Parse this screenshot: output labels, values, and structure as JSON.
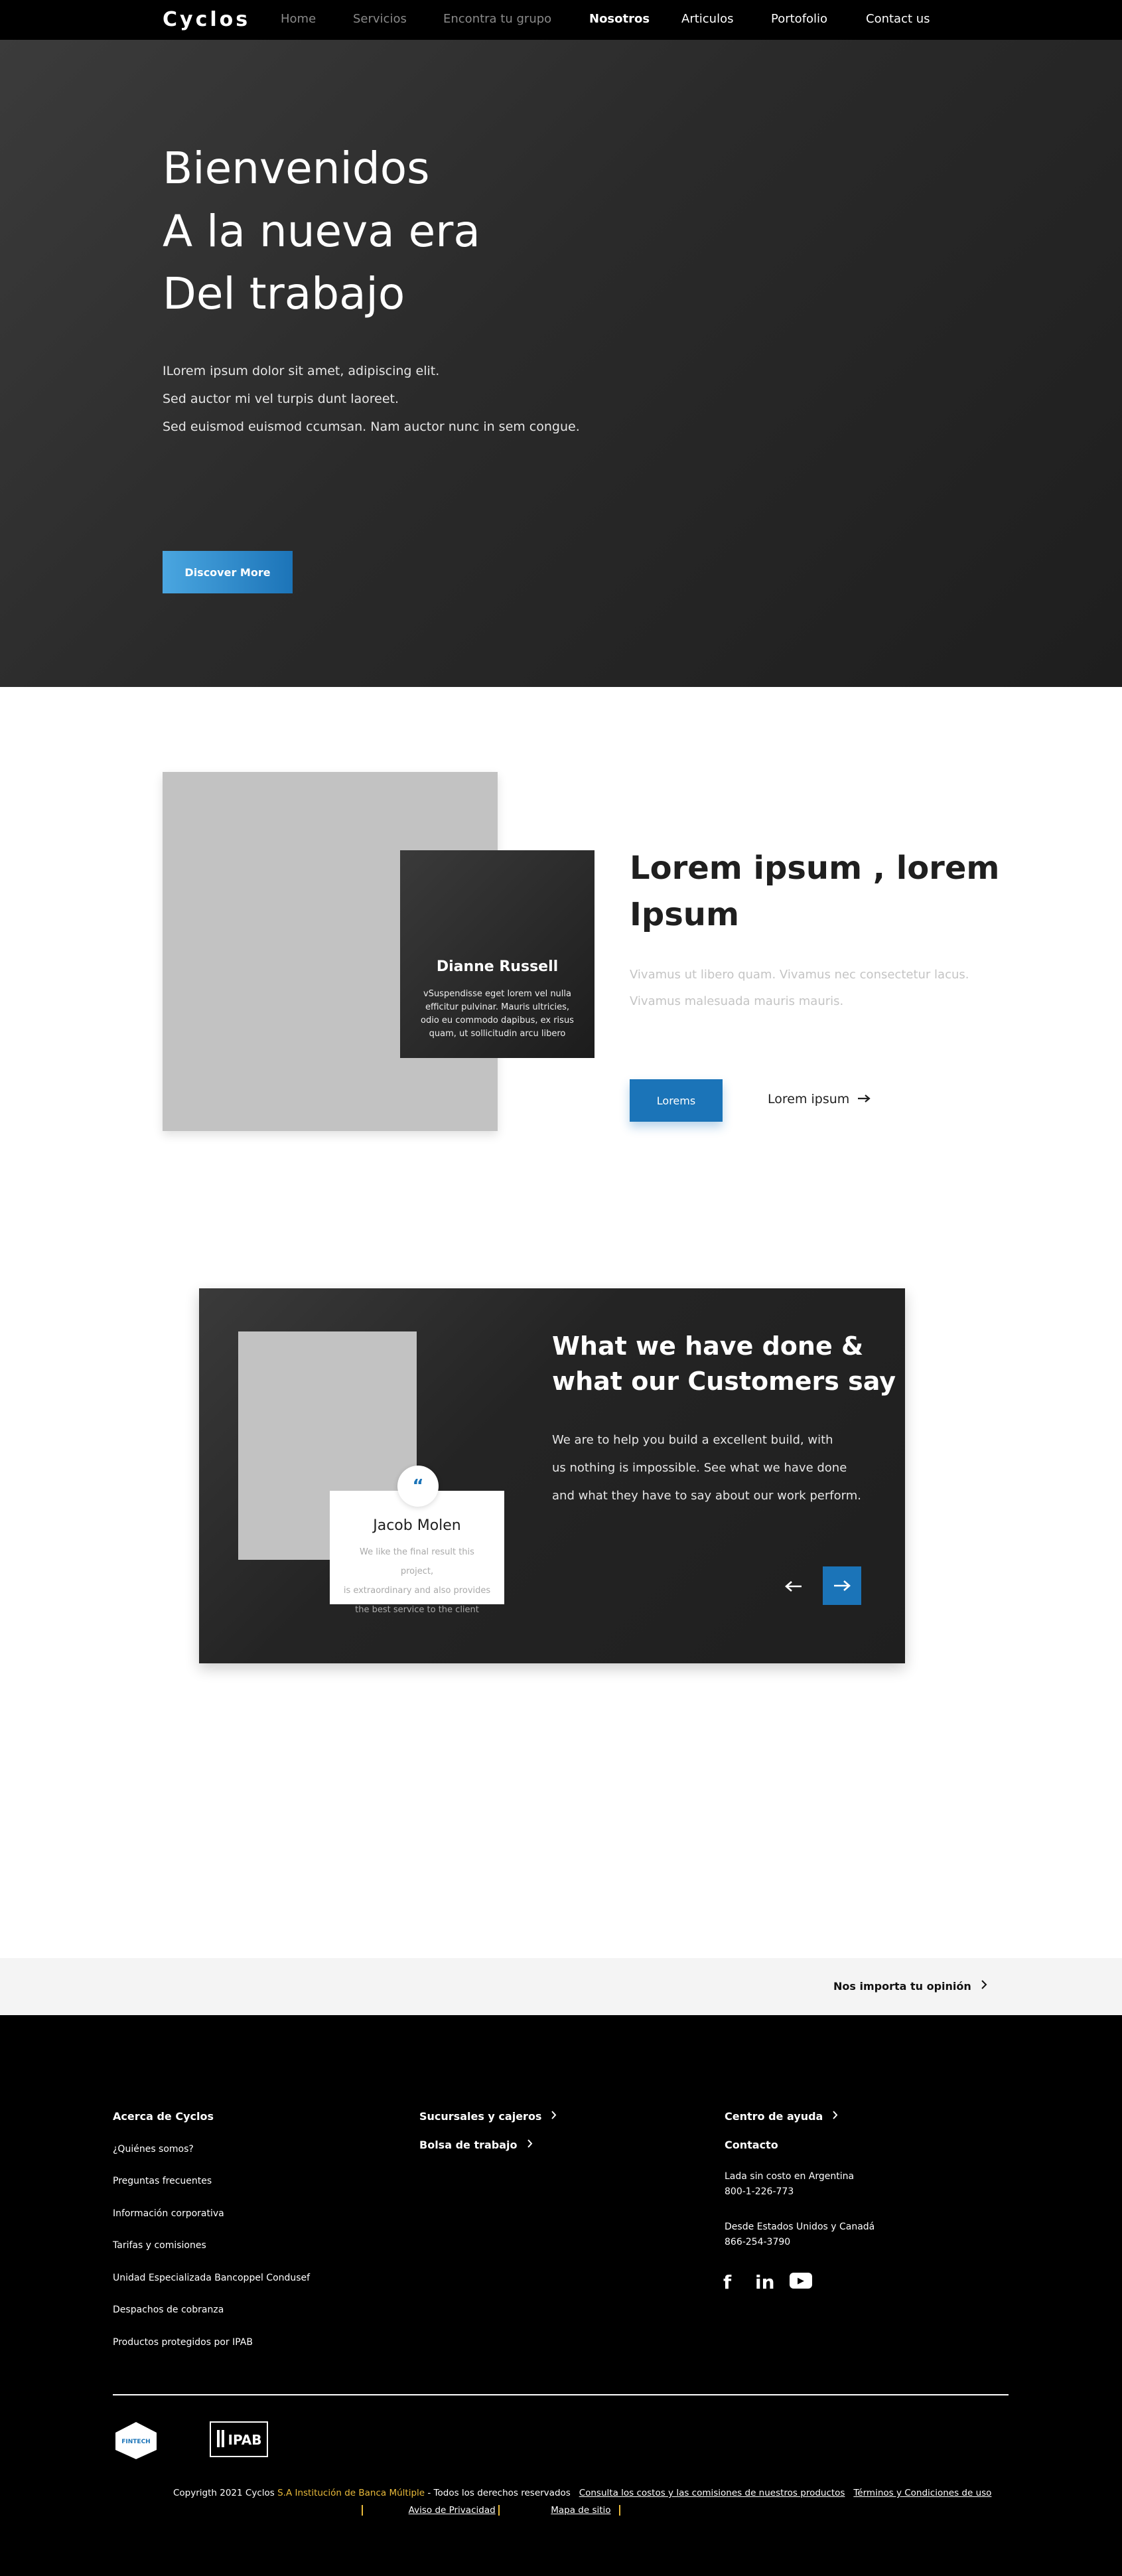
{
  "nav": {
    "logo": "Cyclos",
    "items": [
      "Home",
      "Servicios",
      "Encontra tu grupo",
      "Nosotros",
      "Articulos",
      "Portofolio",
      "Contact us"
    ]
  },
  "hero": {
    "title_lines": [
      "Bienvenidos",
      "A la nueva era",
      "Del trabajo"
    ],
    "text_lines": [
      "ILorem ipsum dolor sit amet, adipiscing elit.",
      "Sed auctor mi vel turpis dunt laoreet.",
      "Sed euismod euismod ccumsan. Nam auctor nunc in sem congue."
    ],
    "button": "Discover More"
  },
  "about": {
    "person_name": "Dianne Russell",
    "person_desc": "vSuspendisse eget lorem vel nulla\nefficitur pulvinar. Mauris ultricies,\nodio eu commodo dapibus, ex risus\n quam, ut sollicitudin arcu libero",
    "title_lines": [
      "Lorem ipsum , lorem",
      "Ipsum"
    ],
    "text_lines": [
      "Vivamus ut libero quam. Vivamus nec consectetur lacus.",
      "Vivamus malesuada mauris mauris."
    ],
    "button": "Lorems",
    "link": "Lorem ipsum"
  },
  "testimonial": {
    "quote_icon": "quote-icon",
    "name": "Jacob Molen",
    "desc": "We like the final result this project,\nis extraordinary and also provides\nthe best service to the client",
    "title_lines": [
      "What we have done  &",
      "what our Customers say"
    ],
    "text_lines": [
      "We are to help you build a excellent build, with",
      "us nothing is impossible. See what we have done",
      "and what they have to say about our work perform."
    ]
  },
  "opinion": {
    "link": "Nos importa tu opinión"
  },
  "footer": {
    "col1": {
      "heading": "Acerca de Cyclos",
      "links": [
        "¿Quiénes somos?",
        "Preguntas frecuentes",
        "Información corporativa",
        "Tarifas y comisiones",
        "Unidad Especializada Bancoppel Condusef",
        "Despachos de cobranza",
        "Productos protegidos por IPAB"
      ]
    },
    "col2": {
      "links": [
        "Sucursales y cajeros",
        "Bolsa de trabajo"
      ]
    },
    "col3": {
      "help": "Centro de ayuda",
      "contact": "Contacto",
      "lines": [
        "Lada sin costo en Argentina",
        "800-1-226-773",
        "Desde Estados Unidos y Canadá",
        "866-254-3790"
      ],
      "social": [
        "facebook-icon",
        "linkedin-icon",
        "youtube-icon"
      ],
      "social_labels": [
        "f",
        "in",
        "▶"
      ]
    },
    "badges": [
      "FINTECH",
      "IPAB"
    ],
    "copyright": {
      "prefix": "Copyrigth 2021 Cyclos ",
      "highlight": "S.A Institución de Banca Múltiple",
      "suffix": " - Todos los derechos reservados",
      "link1": "Consulta los costos y las comisiones de nuestros productos",
      "link2": "Términos y Condiciones de uso",
      "link3": "Aviso de Privacidad",
      "link4": "Mapa de sitio"
    }
  }
}
